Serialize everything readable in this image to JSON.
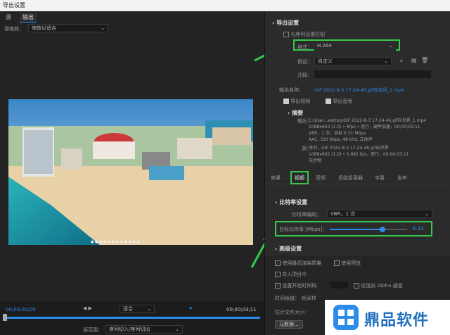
{
  "window": {
    "title": "导出设置"
  },
  "left": {
    "tabs": [
      "源",
      "输出"
    ],
    "scaling_label": "源缩放：",
    "scaling_value": "缩放以适合",
    "timecode_start": "00;00;00;00",
    "timecode_end": "00;00;03;11",
    "zoom_value": "适合",
    "range_label": "源范围：",
    "range_value": "序列切入/序列切出"
  },
  "export": {
    "section_title": "导出设置",
    "match_sequence_label": "与序列设置匹配",
    "format_label": "格式：",
    "format_value": "H.264",
    "preset_label": "预设：",
    "preset_value": "自定义",
    "comment_label": "注释：",
    "output_name_label": "输出名称：",
    "output_name_value": "GIF 2022-8-3 17-24-46.gif向世界_1.mp4",
    "export_video_label": "导出视频",
    "export_audio_label": "导出音频"
  },
  "summary": {
    "title": "摘要",
    "output_label": "输出：",
    "output_lines": [
      "C:\\User...esktop\\GIF 2022-8-3 17-24-46.gif向世界_1.mp4",
      "1088x602 (1.0) • 6fps • 逐行，硬件加速，00;00;03;11",
      "VBR，1 次，目标 6.31 Mbps",
      "AAC, 320 Kbps, 48 kHz, 立体声"
    ],
    "source_label": "源：",
    "source_lines": [
      "序列，GIF 2022-8-3 17-24-46.gif向世界",
      "1088x602 (1.0) • 5.882 fps，逐行，00;00;03;11",
      "无音频"
    ]
  },
  "tabs2": [
    "效果",
    "视频",
    "音频",
    "多路复用器",
    "字幕",
    "发布"
  ],
  "bitrate": {
    "section_title": "比特率设置",
    "encoding_label": "比特率编码：",
    "encoding_value": "VBR，1 次",
    "target_label": "目标比特率 [Mbps]：",
    "target_value": "6.31",
    "target_fraction": 0.68
  },
  "advanced": {
    "section_title": "高级设置"
  },
  "options": {
    "max_render_quality": "使用最高渲染质量",
    "use_preview": "使用预览",
    "import_project": "导入项目中",
    "set_start_timecode": "设置开始时间码",
    "render_alpha": "仅渲染 Alpha 通道",
    "time_interp_label": "时间插值：",
    "time_interp_value": "帧采样",
    "est_size_label": "估计文件大小：",
    "metadata_button": "元数据..."
  },
  "watermark": {
    "text": "鼎品软件"
  },
  "colors": {
    "highlight": "#35c84b",
    "accent": "#2d8ceb"
  }
}
